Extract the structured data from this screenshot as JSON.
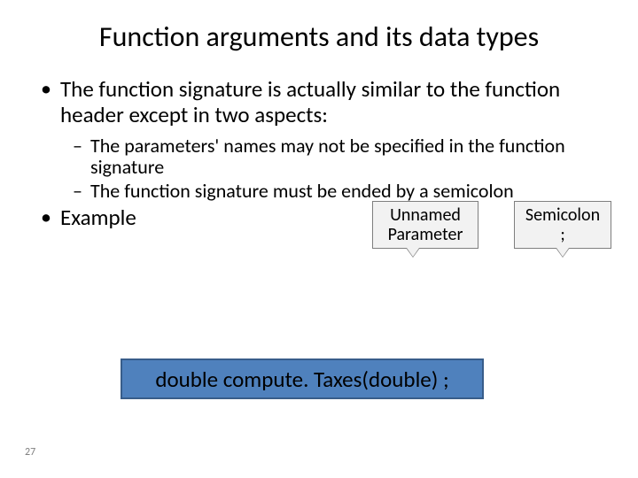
{
  "title": "Function arguments and its data types",
  "bullets": {
    "b1a": "The function signature is actually similar to the function header except in two aspects:",
    "b2a": "The parameters' names may not be specified in the function signature",
    "b2b": "The function signature must be ended by a semicolon",
    "b1b": "Example"
  },
  "callouts": {
    "unnamed_l1": "Unnamed",
    "unnamed_l2": "Parameter",
    "semi_l1": "Semicolon",
    "semi_l2": ";"
  },
  "code": "double compute. Taxes(double) ;",
  "page_number": "27"
}
